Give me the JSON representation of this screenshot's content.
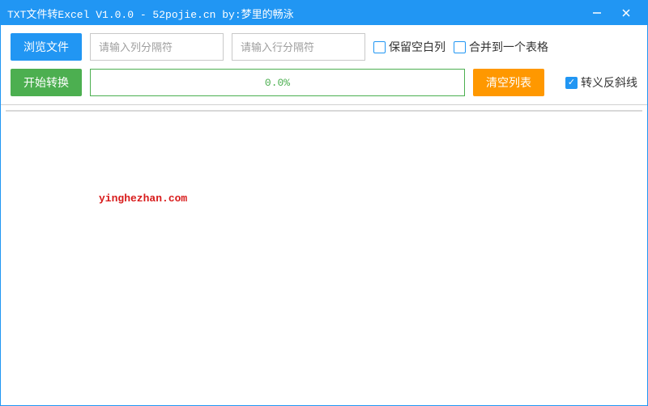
{
  "titlebar": {
    "title": "TXT文件转Excel V1.0.0 - 52pojie.cn by:梦里的畅泳"
  },
  "toolbar": {
    "browse_label": "浏览文件",
    "col_sep_placeholder": "请输入列分隔符",
    "row_sep_placeholder": "请输入行分隔符",
    "keep_blank_label": "保留空白列",
    "merge_label": "合并到一个表格",
    "start_label": "开始转换",
    "progress_text": "0.0%",
    "clear_label": "清空列表",
    "escape_label": "转义反斜线"
  },
  "watermark": "yinghezhan.com"
}
